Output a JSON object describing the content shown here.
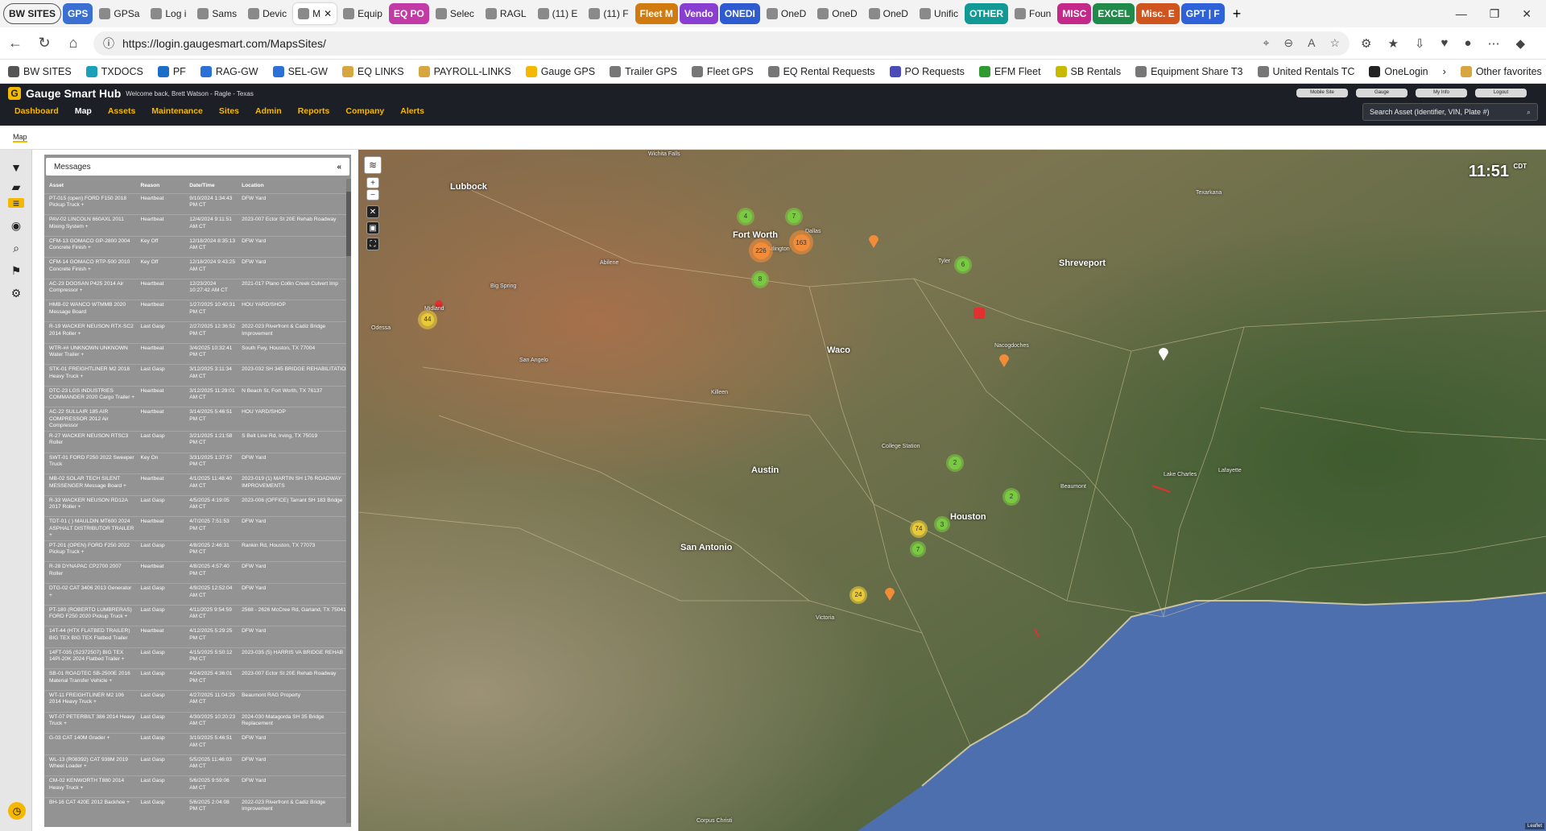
{
  "browser": {
    "tabs": [
      {
        "label": "BW SITES",
        "type": "group"
      },
      {
        "label": "GPS",
        "color": "#3b6fd1"
      },
      {
        "label": "GPSa"
      },
      {
        "label": "Log i"
      },
      {
        "label": "Sams"
      },
      {
        "label": "Devic"
      },
      {
        "label": "M",
        "active": true
      },
      {
        "label": "Equip"
      },
      {
        "label": "EQ PO",
        "color": "#c23aa6"
      },
      {
        "label": "Selec"
      },
      {
        "label": "RAGL"
      },
      {
        "label": "(11) E"
      },
      {
        "label": "(11) F"
      },
      {
        "label": "Fleet M",
        "color": "#d07a10"
      },
      {
        "label": "Vendo",
        "color": "#8a3ed1"
      },
      {
        "label": "ONEDI",
        "color": "#2f5bd1"
      },
      {
        "label": "OneD"
      },
      {
        "label": "OneD"
      },
      {
        "label": "OneD"
      },
      {
        "label": "Unific"
      },
      {
        "label": "OTHER",
        "color": "#119a95"
      },
      {
        "label": "Foun"
      },
      {
        "label": "MISC",
        "color": "#c4298a"
      },
      {
        "label": "EXCEL",
        "color": "#1f8a4a"
      },
      {
        "label": "Misc. E",
        "color": "#d0541e"
      },
      {
        "label": "GPT | F",
        "color": "#2f62d8"
      }
    ],
    "url": "https://login.gaugesmart.com/MapsSites/",
    "bookmarks": [
      "BW SITES",
      "TXDOCS",
      "PF",
      "RAG-GW",
      "SEL-GW",
      "EQ LINKS",
      "PAYROLL-LINKS",
      "Gauge GPS",
      "Trailer GPS",
      "Fleet GPS",
      "EQ Rental Requests",
      "PO Requests",
      "EFM Fleet",
      "SB Rentals",
      "Equipment Share T3",
      "United Rentals TC",
      "OneLogin"
    ],
    "other_favorites": "Other favorites"
  },
  "app": {
    "title": "Gauge Smart Hub",
    "welcome": "Welcome back, Brett Watson - Ragle - Texas",
    "nav": [
      "Dashboard",
      "Map",
      "Assets",
      "Maintenance",
      "Sites",
      "Admin",
      "Reports",
      "Company",
      "Alerts"
    ],
    "active_nav": "Map",
    "header_buttons": [
      "Mobile Site",
      "Gauge",
      "My Info",
      "Logout"
    ],
    "search_placeholder": "Search Asset (Identifier, VIN, Plate #)",
    "subnav_tab": "Map"
  },
  "messages": {
    "title": "Messages",
    "collapse": "«",
    "columns": [
      "Asset",
      "Reason",
      "Date/Time",
      "Location"
    ],
    "rows": [
      [
        "PT-015 (open) FORD F150 2018 Pickup Truck +",
        "Heartbeat",
        "9/10/2024 1:34:43 PM CT",
        "DFW Yard"
      ],
      [
        "PAV-02 LINCOLN 660AXL 2011 Mixing System +",
        "Heartbeat",
        "12/4/2024 9:11:51 AM CT",
        "2023-007 Ector St 20E Rehab Roadway"
      ],
      [
        "CFM-13 GOMACO GP-2800 2004 Concrete Finish +",
        "Key Off",
        "12/18/2024 8:35:13 AM CT",
        "DFW Yard"
      ],
      [
        "CFM-14 GOMACO RTP-500 2010 Concrete Finish +",
        "Key Off",
        "12/18/2024 9:43:25 AM CT",
        "DFW Yard"
      ],
      [
        "AC-23 DOOSAN P425 2014 Air Compressor +",
        "Heartbeat",
        "12/23/2024 10:27:42 AM CT",
        "2021-017 Plano Collin Creek Culvert Imp"
      ],
      [
        "HMB-02 WANCO WTMMB 2020 Message Board",
        "Heartbeat",
        "1/27/2025 10:40:31 PM CT",
        "HOU YARD/SHOP"
      ],
      [
        "R-19 WACKER NEUSON RTX-SC2 2014 Roller +",
        "Last Gasp",
        "2/27/2025 12:36:52 PM CT",
        "2022-023 Riverfront & Cadiz Bridge Improvement"
      ],
      [
        "WTR-## UNKNOWN UNKNOWN Water Trailer +",
        "Heartbeat",
        "3/4/2025 10:32:41 PM CT",
        "South Fwy, Houston, TX 77004"
      ],
      [
        "STK-01 FREIGHTLINER M2 2018 Heavy Truck +",
        "Last Gasp",
        "3/12/2025 3:11:34 AM CT",
        "2023-032 SH 345 BRIDGE REHABILITATION"
      ],
      [
        "DTC-23 LGS INDUSTRIES COMMANDER 2020 Cargo Trailer +",
        "Heartbeat",
        "3/12/2025 11:29:01 AM CT",
        "N Beach St, Fort Worth, TX 76137"
      ],
      [
        "AC-22 SULLAIR 185 AIR COMPRESSOR 2012 Air Compressor",
        "Heartbeat",
        "3/14/2025 5:46:51 PM CT",
        "HOU YARD/SHOP"
      ],
      [
        "R-27 WACKER NEUSON RTSC3 Roller",
        "Last Gasp",
        "3/21/2025 1:21:58 PM CT",
        "S Belt Line Rd, Irving, TX 75019"
      ],
      [
        "SWT-01 FORD F250 2022 Sweeper Truck",
        "Key On",
        "3/31/2025 1:37:57 PM CT",
        "DFW Yard"
      ],
      [
        "MB-02 SOLAR TECH SILENT MESSENGER Message Board +",
        "Heartbeat",
        "4/1/2025 11:48:40 AM CT",
        "2023-019 (1) MARTIN SH 176 ROADWAY IMPROVEMENTS"
      ],
      [
        "R-33 WACKER NEUSON RD12A 2017 Roller +",
        "Last Gasp",
        "4/5/2025 4:19:05 AM CT",
        "2023-006 (OFFICE) Tarrant SH 183 Bridge"
      ],
      [
        "TDT-01 ( ) MAULDIN MT600 2024 ASPHALT DISTRIBUTOR TRAILER +",
        "Heartbeat",
        "4/7/2025 7:51:53 PM CT",
        "DFW Yard"
      ],
      [
        "PT-201 (OPEN) FORD F250 2022 Pickup Truck +",
        "Last Gasp",
        "4/8/2025 2:46:31 PM CT",
        "Rankin Rd, Houston, TX 77073"
      ],
      [
        "R-28 DYNAPAC CP2700 2007 Roller",
        "Heartbeat",
        "4/8/2025 4:57:40 PM CT",
        "DFW Yard"
      ],
      [
        "DTG-02 CAT 3406 2013 Generator +",
        "Last Gasp",
        "4/9/2025 12:52:04 AM CT",
        "DFW Yard"
      ],
      [
        "PT-180 (ROBERTO LUMBRERAS) FORD F250 2020 Pickup Truck +",
        "Last Gasp",
        "4/11/2025 9:54:59 AM CT",
        "2568 - 2626 McCree Rd, Garland, TX 75041"
      ],
      [
        "14T-44 (HTX FLATBED TRAILER) BIG TEX BIG TEX Flatbed Trailer",
        "Heartbeat",
        "4/12/2025 5:29:25 PM CT",
        "DFW Yard"
      ],
      [
        "14FT-035 (S2372507) BIG TEX 14PI-20K 2024 Flatbed Trailer +",
        "Last Gasp",
        "4/15/2025 5:50:12 PM CT",
        "2023-035 (5) HARRIS VA BRIDGE REHAB"
      ],
      [
        "SB-01 ROADTEC SB-2500E 2016 Material Transfer Vehicle +",
        "Last Gasp",
        "4/24/2025 4:36:01 PM CT",
        "2023-007 Ector St 20E Rehab Roadway"
      ],
      [
        "WT-11 FREIGHTLINER M2 106 2014 Heavy Truck +",
        "Last Gasp",
        "4/27/2025 11:04:29 AM CT",
        "Beaumont RAG Property"
      ],
      [
        "WT-07 PETERBILT 386 2014 Heavy Truck +",
        "Last Gasp",
        "4/30/2025 10:20:23 AM CT",
        "2024-030 Matagorda SH 35 Bridge Replacement"
      ],
      [
        "G-03 CAT 140M Grader +",
        "Last Gasp",
        "3/10/2025 5:46:51 AM CT",
        "DFW Yard"
      ],
      [
        "WL-13 (R08392) CAT 938M 2019 Wheel Loader +",
        "Last Gasp",
        "5/5/2025 11:46:03 AM CT",
        "DFW Yard"
      ],
      [
        "CM-02 KENWORTH T880 2014 Heavy Truck +",
        "Last Gasp",
        "5/6/2025 9:59:06 AM CT",
        "DFW Yard"
      ],
      [
        "BH-16 CAT 420E 2012 Backhoe +",
        "Last Gasp",
        "5/6/2025 2:04:08 PM CT",
        "2022-023 Riverfront & Cadiz Bridge Improvement"
      ]
    ]
  },
  "map": {
    "clock": "11:51",
    "tz": "CDT",
    "zoom_in": "+",
    "zoom_out": "−",
    "attribution": "Leaflet",
    "cities": [
      "Lubbock",
      "Fort Worth",
      "Arlington",
      "Waco",
      "Austin",
      "San Antonio",
      "Houston",
      "Shreveport",
      "Beaumont",
      "Lafayette",
      "Nacogdoches",
      "Midland",
      "Abilene",
      "Tyler",
      "Dallas",
      "Killeen",
      "College Station",
      "Victoria",
      "Lake Charles",
      "Corpus Christi",
      "Odessa",
      "San Angelo",
      "Big Spring",
      "Texarkana",
      "Wichita Falls"
    ],
    "clusters": [
      {
        "label": "4",
        "color": "#7ac943"
      },
      {
        "label": "7",
        "color": "#7ac943"
      },
      {
        "label": "226",
        "color": "#f28c38"
      },
      {
        "label": "163",
        "color": "#f28c38"
      },
      {
        "label": "8",
        "color": "#7ac943"
      },
      {
        "label": "6",
        "color": "#7ac943"
      },
      {
        "label": "44",
        "color": "#e8c93a"
      },
      {
        "label": "2",
        "color": "#7ac943"
      },
      {
        "label": "2",
        "color": "#7ac943"
      },
      {
        "label": "74",
        "color": "#e8c93a"
      },
      {
        "label": "3",
        "color": "#7ac943"
      },
      {
        "label": "7",
        "color": "#7ac943"
      },
      {
        "label": "24",
        "color": "#e8c93a"
      }
    ]
  }
}
